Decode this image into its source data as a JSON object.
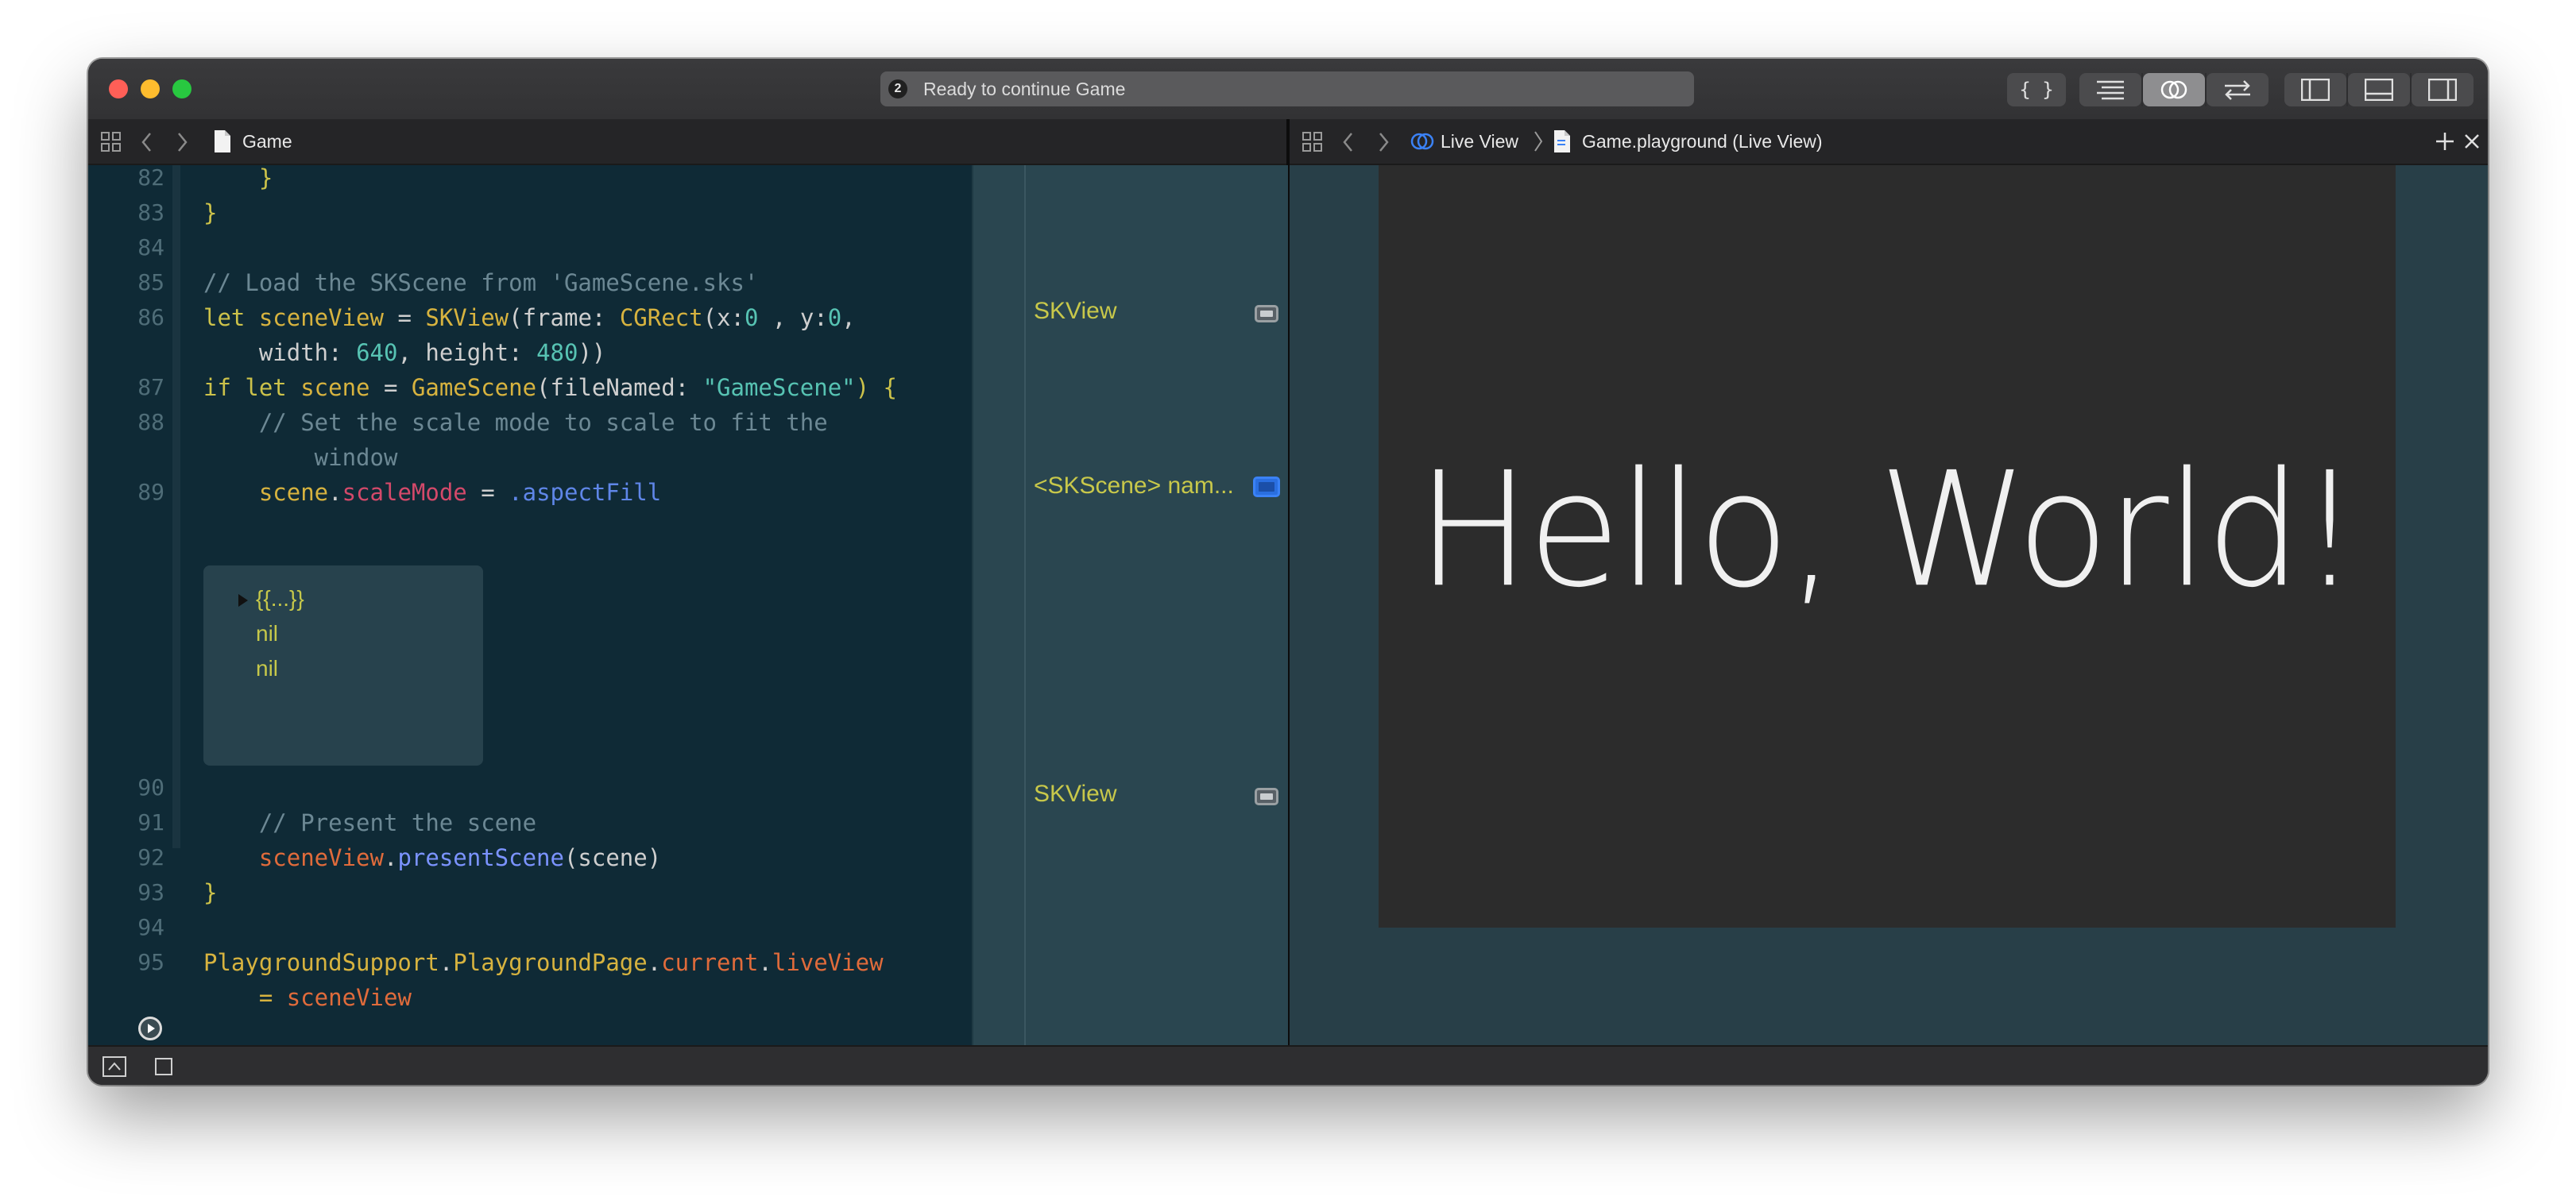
{
  "toolbar": {
    "activity_badge": "2",
    "activity_status": "Ready to continue Game",
    "code_snippets_label": "{ }"
  },
  "left_jumpbar": {
    "file": "Game"
  },
  "right_jumpbar": {
    "crumb1": "Live View",
    "crumb2": "Game.playground (Live View)"
  },
  "editor": {
    "line_numbers": [
      "82",
      "83",
      "84",
      "85",
      "86",
      "87",
      "88",
      "89",
      "90",
      "91",
      "92",
      "93",
      "94",
      "95"
    ],
    "lines": {
      "l82": "    }",
      "l83": "}",
      "l85": "// Load the SKScene from 'GameScene.sks'",
      "l86a_kw": "let ",
      "l86a_var": "sceneView",
      "l86a_eq": " = ",
      "l86a_ty1": "SKView",
      "l86a_p1": "(frame: ",
      "l86a_ty2": "CGRect",
      "l86a_p2": "(x:",
      "l86a_n1": "0",
      "l86a_p3": " , y:",
      "l86a_n2": "0",
      "l86a_p4": ",",
      "l86b_p1": "    width: ",
      "l86b_n1": "640",
      "l86b_p2": ", height: ",
      "l86b_n2": "480",
      "l86b_p3": "))",
      "l87_kw": "if let ",
      "l87_var": "scene",
      "l87_eq": " = ",
      "l87_ty": "GameScene",
      "l87_p1": "(fileNamed: ",
      "l87_str": "\"GameScene\"",
      "l87_p2": ") {",
      "l88a": "    // Set the scale mode to scale to fit the",
      "l88b": "        window",
      "l89_ind": "    ",
      "l89_var": "scene",
      "l89_dot": ".",
      "l89_prop": "scaleMode",
      "l89_eq": " = ",
      "l89_val": ".aspectFill",
      "l91": "    // Present the scene",
      "l92_ind": "    ",
      "l92_var": "sceneView",
      "l92_dot": ".",
      "l92_method": "presentScene",
      "l92_p": "(scene)",
      "l93": "}",
      "l95a_ty1": "PlaygroundSupport",
      "l95a_d1": ".",
      "l95a_ty2": "PlaygroundPage",
      "l95a_d2": ".",
      "l95a_prop1": "current",
      "l95a_d3": ".",
      "l95a_prop2": "liveView",
      "l95b_p": "    = ",
      "l95b_var": "sceneView"
    },
    "popover": {
      "row1": "{{...}}",
      "row2": "nil",
      "row3": "nil"
    }
  },
  "results": {
    "r86": "SKView",
    "r89": "<SKScene> nam...",
    "r92": "SKView"
  },
  "live_view": {
    "text": "Hello, World!"
  },
  "colors": {
    "editor_bg": "#0f2a36",
    "results_bg": "#2a4650",
    "scene_bg": "#2c2c2c",
    "accent": "#3b82f6"
  }
}
